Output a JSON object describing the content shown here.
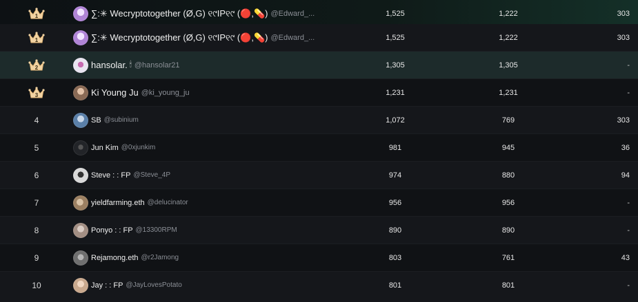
{
  "leaderboard": {
    "rows": [
      {
        "rank": "1",
        "crown": true,
        "name": "∑:✳ Wecryptotogether (Ø,G) ୧୯IP୧୯ (🔴,💊)",
        "handle": "@Edward_...",
        "avatar_color": "#b084d6",
        "col_a": "1,525",
        "col_b": "1,222",
        "col_c": "303",
        "style": "pinned"
      },
      {
        "rank": "1",
        "crown": true,
        "name": "∑:✳ Wecryptotogether (Ø,G) ୧୯IP୧୯ (🔴,💊)",
        "handle": "@Edward_...",
        "avatar_color": "#b084d6",
        "col_a": "1,525",
        "col_b": "1,222",
        "col_c": "303",
        "style": "odd"
      },
      {
        "rank": "2",
        "crown": true,
        "name": "hansolar.",
        "emoji": "🕯",
        "handle": "@hansolar21",
        "avatar_color": "#e9e4f0",
        "col_a": "1,305",
        "col_b": "1,305",
        "col_c": "-",
        "style": "highlight"
      },
      {
        "rank": "3",
        "crown": true,
        "name": "Ki Young Ju",
        "handle": "@ki_young_ju",
        "avatar_color": "#8a6a55",
        "col_a": "1,231",
        "col_b": "1,231",
        "col_c": "-",
        "style": "even"
      },
      {
        "rank": "4",
        "crown": false,
        "name": "SB",
        "handle": "@subinium",
        "avatar_color": "#5a7fa8",
        "col_a": "1,072",
        "col_b": "769",
        "col_c": "303",
        "style": "odd"
      },
      {
        "rank": "5",
        "crown": false,
        "name": "Jun Kim",
        "handle": "@0xjunkim",
        "avatar_color": "#222428",
        "col_a": "981",
        "col_b": "945",
        "col_c": "36",
        "style": "even"
      },
      {
        "rank": "6",
        "crown": false,
        "name": "Steve : : FP",
        "handle": "@Steve_4P",
        "avatar_color": "#d9d9d9",
        "col_a": "974",
        "col_b": "880",
        "col_c": "94",
        "style": "odd"
      },
      {
        "rank": "7",
        "crown": false,
        "name": "yieldfarming.eth",
        "handle": "@delucinator",
        "avatar_color": "#9c8062",
        "col_a": "956",
        "col_b": "956",
        "col_c": "-",
        "style": "even"
      },
      {
        "rank": "8",
        "crown": false,
        "name": "Ponyo : : FP",
        "handle": "@13300RPM",
        "avatar_color": "#a28e83",
        "col_a": "890",
        "col_b": "890",
        "col_c": "-",
        "style": "odd"
      },
      {
        "rank": "9",
        "crown": false,
        "name": "Rejamong.eth",
        "handle": "@r2Jamong",
        "avatar_color": "#6f6f6f",
        "col_a": "803",
        "col_b": "761",
        "col_c": "43",
        "style": "even"
      },
      {
        "rank": "10",
        "crown": false,
        "name": "Jay : : FP",
        "handle": "@JayLovesPotato",
        "avatar_color": "#c9a98e",
        "col_a": "801",
        "col_b": "801",
        "col_c": "-",
        "style": "odd"
      }
    ]
  }
}
